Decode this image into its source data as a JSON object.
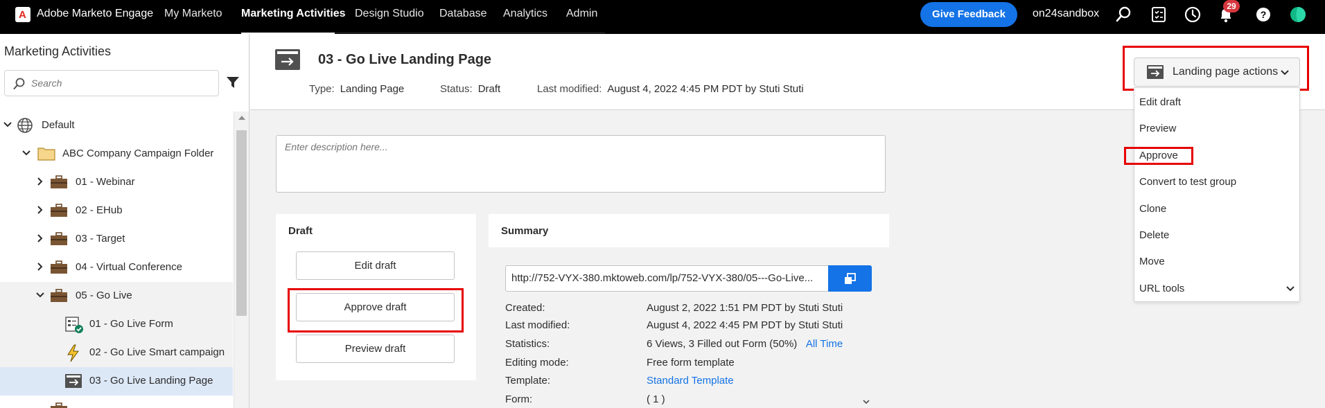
{
  "topbar": {
    "brand": "Adobe Marketo Engage",
    "nav": [
      "My Marketo",
      "Marketing Activities",
      "Design Studio",
      "Database",
      "Analytics",
      "Admin"
    ],
    "active_nav": "Marketing Activities",
    "feedback_label": "Give Feedback",
    "user": "on24sandbox",
    "notification_count": "29",
    "icons": [
      "search-icon",
      "tasks-icon",
      "history-icon",
      "bell-icon",
      "help-icon",
      "avatar"
    ]
  },
  "sidebar": {
    "title": "Marketing Activities",
    "search_placeholder": "Search",
    "tree": [
      {
        "label": "Default",
        "icon": "globe-icon"
      },
      {
        "label": "ABC Company Campaign Folder",
        "icon": "folder-icon"
      },
      {
        "label": "01 - Webinar",
        "icon": "briefcase-icon"
      },
      {
        "label": "02 - EHub",
        "icon": "briefcase-icon"
      },
      {
        "label": "03 - Target",
        "icon": "briefcase-icon"
      },
      {
        "label": "04 - Virtual Conference",
        "icon": "briefcase-icon"
      },
      {
        "label": "05 - Go Live",
        "icon": "briefcase-icon"
      },
      {
        "label": "01 - Go Live Form",
        "icon": "form-approved-icon"
      },
      {
        "label": "02 - Go Live Smart campaign",
        "icon": "lightning-icon"
      },
      {
        "label": "03 - Go Live Landing Page",
        "icon": "landing-page-icon"
      }
    ]
  },
  "header": {
    "title": "03 - Go Live Landing Page",
    "type_label": "Type:",
    "type_value": "Landing Page",
    "status_label": "Status:",
    "status_value": "Draft",
    "modified_label": "Last modified:",
    "modified_value": "August 4, 2022 4:45 PM PDT by Stuti Stuti"
  },
  "actions": {
    "button_label": "Landing page actions",
    "menu": [
      "Edit draft",
      "Preview",
      "Approve",
      "Convert to test group",
      "Clone",
      "Delete",
      "Move",
      "URL tools"
    ]
  },
  "description": {
    "placeholder": "Enter description here..."
  },
  "draft": {
    "title": "Draft",
    "edit": "Edit draft",
    "approve": "Approve draft",
    "preview": "Preview draft"
  },
  "summary": {
    "title": "Summary",
    "url": "http://752-VYX-380.mktoweb.com/lp/752-VYX-380/05---Go-Live...",
    "rows": [
      {
        "label": "Created:",
        "value": "August 2, 2022 1:51 PM PDT by Stuti Stuti"
      },
      {
        "label": "Last modified:",
        "value": "August 4, 2022 4:45 PM PDT by Stuti Stuti"
      },
      {
        "label": "Statistics:",
        "value": "6 Views, 3 Filled out Form (50%)",
        "link": "All Time"
      },
      {
        "label": "Editing mode:",
        "value": "Free form template"
      },
      {
        "label": "Template:",
        "link": "Standard Template"
      },
      {
        "label": "Form:",
        "value": "( 1 )"
      }
    ]
  },
  "colors": {
    "accent": "#1473e6",
    "highlight": "#e60000",
    "topbar": "#000000"
  }
}
